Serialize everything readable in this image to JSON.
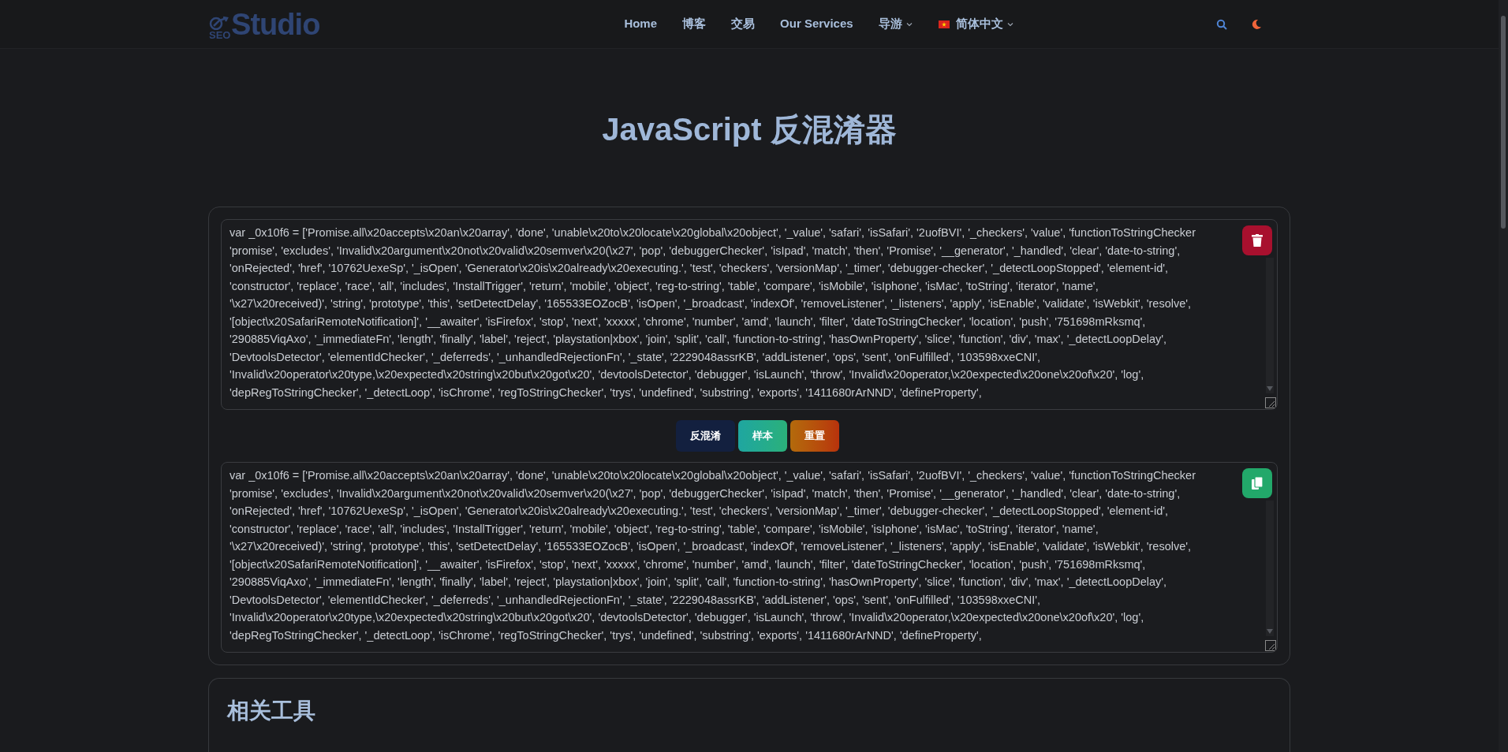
{
  "logo": {
    "small": "SEO",
    "main": "Studio"
  },
  "nav": [
    {
      "label": "Home",
      "kind": "link"
    },
    {
      "label": "博客",
      "kind": "link"
    },
    {
      "label": "交易",
      "kind": "link"
    },
    {
      "label": "Our Services",
      "kind": "link"
    },
    {
      "label": "导游",
      "kind": "dropdown"
    },
    {
      "label": "简体中文",
      "kind": "language"
    }
  ],
  "title": "JavaScript 反混淆器",
  "input": {
    "lines": [
      "var _0x10f6 = ['Promise.all\\x20accepts\\x20an\\x20array', 'done', 'unable\\x20to\\x20locate\\x20global\\x20object', '_value', 'safari', 'isSafari', '2uofBVI', '_checkers', 'value', 'functionToStringChecker",
      "'promise', 'excludes', 'Invalid\\x20argument\\x20not\\x20valid\\x20semver\\x20(\\x27', 'pop', 'debuggerChecker', 'isIpad', 'match', 'then', 'Promise', '__generator', '_handled', 'clear', 'date-to-string',",
      "'onRejected', 'href', '10762UexeSp', '_isOpen', 'Generator\\x20is\\x20already\\x20executing.', 'test', 'checkers', 'versionMap', '_timer', 'debugger-checker', '_detectLoopStopped', 'element-id',",
      "'constructor', 'replace', 'race', 'all', 'includes', 'InstallTrigger', 'return', 'mobile', 'object', 'reg-to-string', 'table', 'compare', 'isMobile', 'isIphone', 'isMac', 'toString', 'iterator', 'name',",
      "'\\x27\\x20received)', 'string', 'prototype', 'this', 'setDetectDelay', '165533EOZocB', 'isOpen', '_broadcast', 'indexOf', 'removeListener', '_listeners', 'apply', 'isEnable', 'validate', 'isWebkit', 'resolve',",
      "'[object\\x20SafariRemoteNotification]', '__awaiter', 'isFirefox', 'stop', 'next', 'xxxxx', 'chrome', 'number', 'amd', 'launch', 'filter', 'dateToStringChecker', 'location', 'push', '751698mRksmq',",
      "'290885ViqAxo', '_immediateFn', 'length', 'finally', 'label', 'reject', 'playstation|xbox', 'join', 'split', 'call', 'function-to-string', 'hasOwnProperty', 'slice', 'function', 'div', 'max', '_detectLoopDelay',",
      "'DevtoolsDetector', 'elementIdChecker', '_deferreds', '_unhandledRejectionFn', '_state', '2229048assrKB', 'addListener', 'ops', 'sent', 'onFulfilled', '103598xxeCNI',",
      "'Invalid\\x20operator\\x20type,\\x20expected\\x20string\\x20but\\x20got\\x20', 'devtoolsDetector', 'debugger', 'isLaunch', 'throw', 'Invalid\\x20operator,\\x20expected\\x20one\\x20of\\x20', 'log',",
      "'depRegToStringChecker', '_detectLoop', 'isChrome', 'regToStringChecker', 'trys', 'undefined', 'substring', 'exports', '1411680rArNND', 'defineProperty',"
    ]
  },
  "actions": [
    {
      "label": "反混淆",
      "kind": "primary"
    },
    {
      "label": "样本",
      "kind": "sample"
    },
    {
      "label": "重置",
      "kind": "reset"
    }
  ],
  "output": {
    "lines": [
      "var _0x10f6 = ['Promise.all\\x20accepts\\x20an\\x20array', 'done', 'unable\\x20to\\x20locate\\x20global\\x20object', '_value', 'safari', 'isSafari', '2uofBVI', '_checkers', 'value', 'functionToStringChecker",
      "'promise', 'excludes', 'Invalid\\x20argument\\x20not\\x20valid\\x20semver\\x20(\\x27', 'pop', 'debuggerChecker', 'isIpad', 'match', 'then', 'Promise', '__generator', '_handled', 'clear', 'date-to-string',",
      "'onRejected', 'href', '10762UexeSp', '_isOpen', 'Generator\\x20is\\x20already\\x20executing.', 'test', 'checkers', 'versionMap', '_timer', 'debugger-checker', '_detectLoopStopped', 'element-id',",
      "'constructor', 'replace', 'race', 'all', 'includes', 'InstallTrigger', 'return', 'mobile', 'object', 'reg-to-string', 'table', 'compare', 'isMobile', 'isIphone', 'isMac', 'toString', 'iterator', 'name',",
      "'\\x27\\x20received)', 'string', 'prototype', 'this', 'setDetectDelay', '165533EOZocB', 'isOpen', '_broadcast', 'indexOf', 'removeListener', '_listeners', 'apply', 'isEnable', 'validate', 'isWebkit', 'resolve',",
      "'[object\\x20SafariRemoteNotification]', '__awaiter', 'isFirefox', 'stop', 'next', 'xxxxx', 'chrome', 'number', 'amd', 'launch', 'filter', 'dateToStringChecker', 'location', 'push', '751698mRksmq',",
      "'290885ViqAxo', '_immediateFn', 'length', 'finally', 'label', 'reject', 'playstation|xbox', 'join', 'split', 'call', 'function-to-string', 'hasOwnProperty', 'slice', 'function', 'div', 'max', '_detectLoopDelay',",
      "'DevtoolsDetector', 'elementIdChecker', '_deferreds', '_unhandledRejectionFn', '_state', '2229048assrKB', 'addListener', 'ops', 'sent', 'onFulfilled', '103598xxeCNI',",
      "'Invalid\\x20operator\\x20type,\\x20expected\\x20string\\x20but\\x20got\\x20', 'devtoolsDetector', 'debugger', 'isLaunch', 'throw', 'Invalid\\x20operator,\\x20expected\\x20one\\x20of\\x20', 'log',",
      "'depRegToStringChecker', '_detectLoop', 'isChrome', 'regToStringChecker', 'trys', 'undefined', 'substring', 'exports', '1411680rArNND', 'defineProperty',"
    ]
  },
  "related": {
    "heading": "相关工具"
  }
}
